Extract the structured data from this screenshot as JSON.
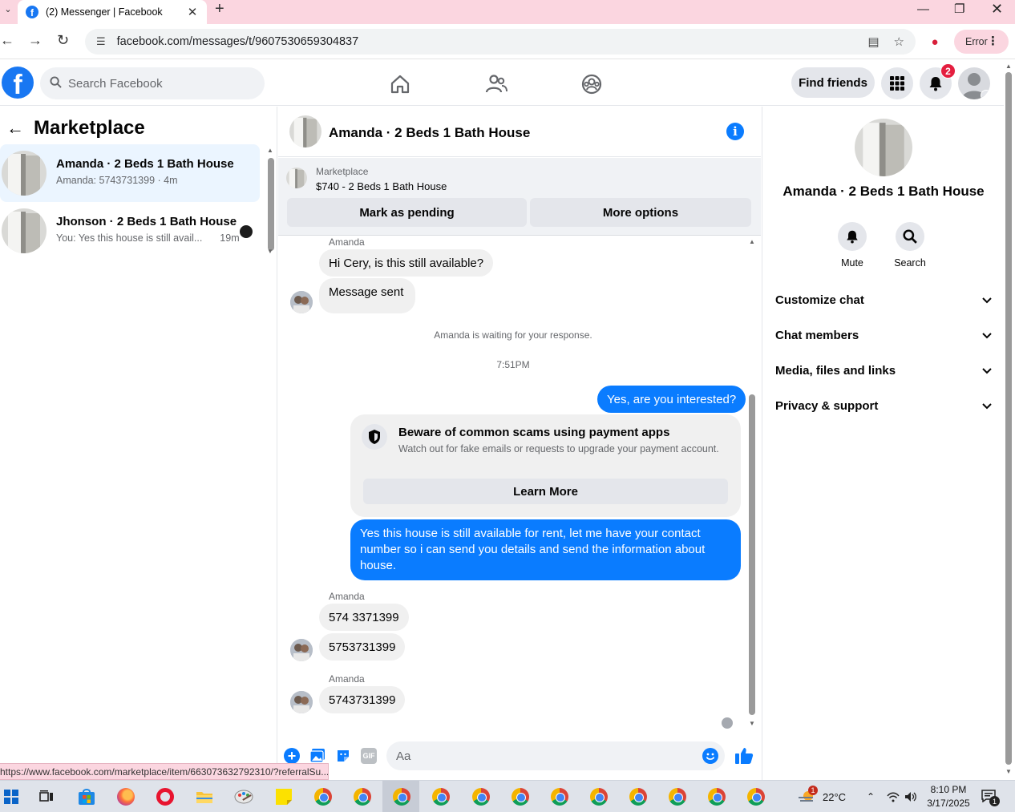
{
  "browser": {
    "tab_title": "(2) Messenger | Facebook",
    "url": "facebook.com/messages/t/9607530659304837",
    "error_label": "Error",
    "status_url": "https://www.facebook.com/marketplace/item/663073632792310/?referralSu..."
  },
  "fb_header": {
    "search_placeholder": "Search Facebook",
    "find_friends": "Find friends",
    "notifications_count": "2"
  },
  "left": {
    "title": "Marketplace",
    "conversations": [
      {
        "name": "Amanda · 2 Beds 1 Bath House",
        "snippet": "Amanda: 5743731399 · 4m"
      },
      {
        "name": "Jhonson · 2 Beds 1 Bath House",
        "snippet": "You: Yes this house is still avail...",
        "time": "19m"
      }
    ]
  },
  "chat": {
    "title": "Amanda · 2 Beds 1 Bath House",
    "listing": {
      "category": "Marketplace",
      "price_title": "$740 - 2 Beds 1 Bath House",
      "mark_pending": "Mark as pending",
      "more_options": "More options"
    },
    "messages": {
      "sender1": "Amanda",
      "m1": "Hi Cery, is this still available?",
      "m2": "Message sent",
      "waiting": "Amanda is waiting for your response.",
      "time": "7:51PM",
      "out1": "Yes, are you interested?",
      "scam_title": "Beware of common scams using payment apps",
      "scam_text": "Watch out for fake emails or requests to upgrade your payment account.",
      "learn_more": "Learn More",
      "out2": "Yes this house is still available for rent, let me have your contact number so i can send you details and send the information about house.",
      "sender2": "Amanda",
      "m3": "574 3371399",
      "m4": "5753731399",
      "sender3": "Amanda",
      "m5": "5743731399"
    },
    "composer_placeholder": "Aa"
  },
  "right": {
    "name": "Amanda · 2 Beds 1 Bath House",
    "mute": "Mute",
    "search": "Search",
    "sections": [
      "Customize chat",
      "Chat members",
      "Media, files and links",
      "Privacy & support"
    ]
  },
  "taskbar": {
    "weather": "22°C",
    "time": "8:10 PM",
    "date": "3/17/2025",
    "weather_badge": "1",
    "notif_count": "1"
  },
  "colors": {
    "fb_blue": "#1877f2",
    "messenger_blue": "#0a7cff",
    "tabstrip_pink": "#fbd6e0",
    "notification_red": "#e41e3f"
  }
}
